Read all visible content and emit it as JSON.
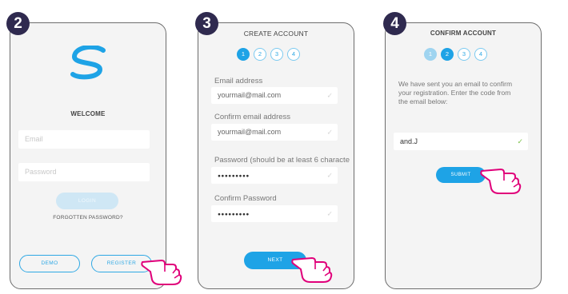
{
  "steps": [
    "2",
    "3",
    "4"
  ],
  "screen1": {
    "welcome": "WELCOME",
    "email_placeholder": "Email",
    "password_placeholder": "Password",
    "login_label": "LOGIN",
    "forgot_label": "FORGOTTEN PASSWORD?",
    "demo_label": "DEMO",
    "register_label": "REGISTER"
  },
  "screen2": {
    "title": "CREATE ACCOUNT",
    "dots": [
      "1",
      "2",
      "3",
      "4"
    ],
    "email_label": "Email address",
    "email_value": "yourmail@mail.com",
    "confirm_email_label": "Confirm email address",
    "confirm_email_value": "yourmail@mail.com",
    "password_label": "Password (should be at least 6 characte",
    "password_value": "●●●●●●●●●",
    "confirm_password_label": "Confirm Password",
    "confirm_password_value": "●●●●●●●●●",
    "next_label": "NEXT"
  },
  "screen3": {
    "title": "CONFIRM ACCOUNT",
    "dots": [
      "1",
      "2",
      "3",
      "4"
    ],
    "message_1": "We have sent you an email to confirm",
    "message_2": "your registration. Enter the code from",
    "message_3": "the email below:",
    "code_value": "and.J",
    "submit_label": "SUBMIT"
  },
  "colors": {
    "accent": "#1ea3e6",
    "badge": "#2f2a4f",
    "check_ok": "#7cc14a"
  }
}
